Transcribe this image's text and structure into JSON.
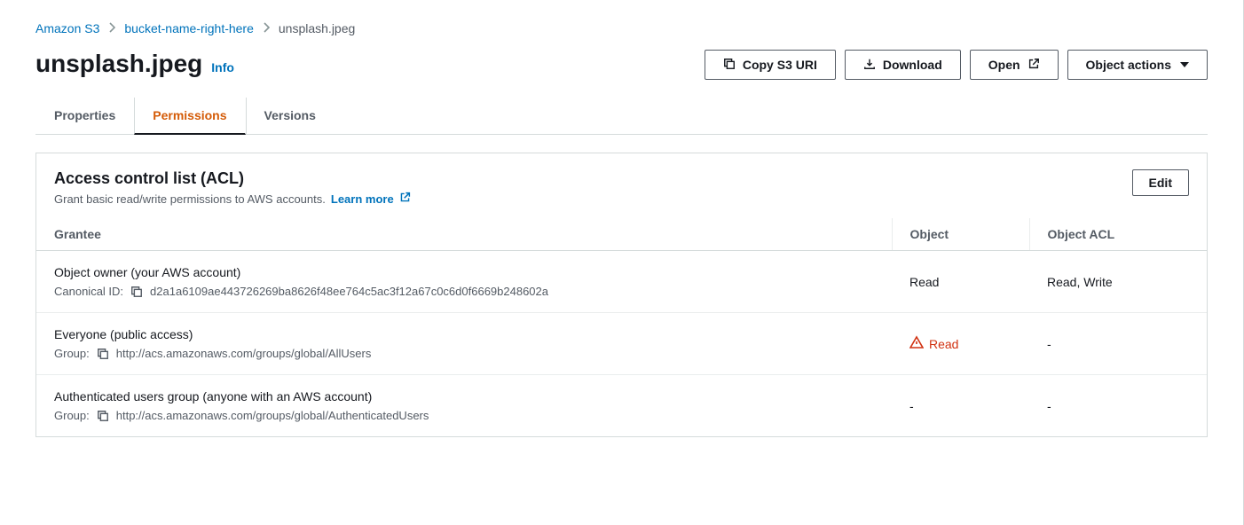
{
  "breadcrumb": {
    "root": "Amazon S3",
    "bucket": "bucket-name-right-here",
    "object": "unsplash.jpeg"
  },
  "header": {
    "title": "unsplash.jpeg",
    "info": "Info"
  },
  "actions": {
    "copy_uri": "Copy S3 URI",
    "download": "Download",
    "open": "Open",
    "object_actions": "Object actions"
  },
  "tabs": {
    "properties": "Properties",
    "permissions": "Permissions",
    "versions": "Versions"
  },
  "acl": {
    "title": "Access control list (ACL)",
    "desc": "Grant basic read/write permissions to AWS accounts.",
    "learn_more": "Learn more",
    "edit": "Edit",
    "columns": {
      "grantee": "Grantee",
      "object": "Object",
      "object_acl": "Object ACL"
    },
    "rows": [
      {
        "title": "Object owner (your AWS account)",
        "sub_label": "Canonical ID:",
        "sub_value": "d2a1a6109ae443726269ba8626f48ee764c5ac3f12a67c0c6d0f6669b248602a",
        "object": "Read",
        "object_warn": false,
        "acl": "Read, Write"
      },
      {
        "title": "Everyone (public access)",
        "sub_label": "Group:",
        "sub_value": "http://acs.amazonaws.com/groups/global/AllUsers",
        "object": "Read",
        "object_warn": true,
        "acl": "-"
      },
      {
        "title": "Authenticated users group (anyone with an AWS account)",
        "sub_label": "Group:",
        "sub_value": "http://acs.amazonaws.com/groups/global/AuthenticatedUsers",
        "object": "-",
        "object_warn": false,
        "acl": "-"
      }
    ]
  }
}
